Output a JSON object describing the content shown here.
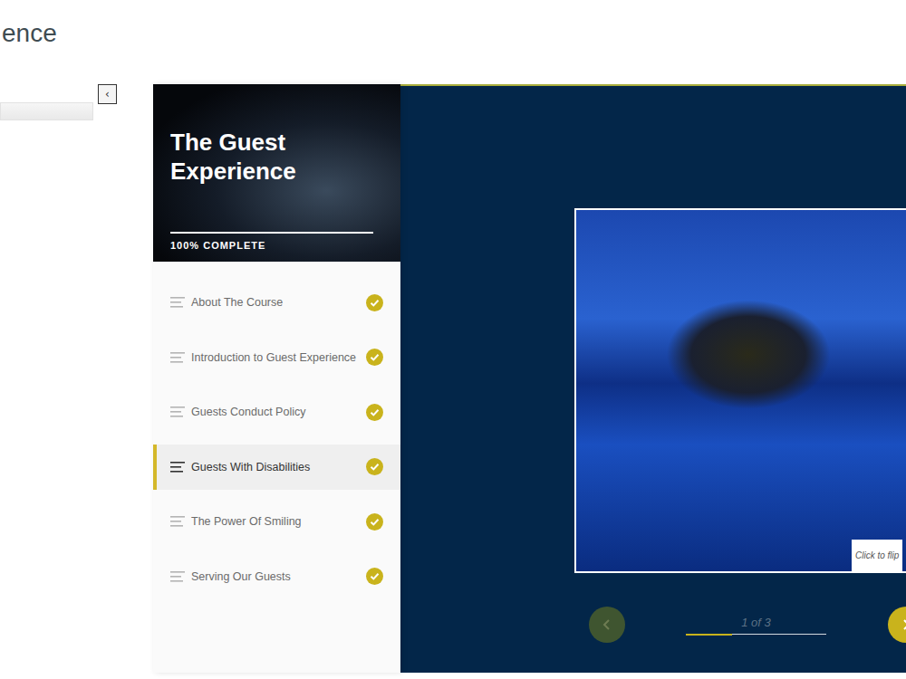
{
  "page": {
    "title": "ence"
  },
  "outline": {
    "toggle_icon": "‹",
    "search": {
      "value": ""
    }
  },
  "course": {
    "title": "The Guest Experience",
    "progress": "100% COMPLETE",
    "level": 1.0
  },
  "lessons": [
    {
      "label": "About The Course",
      "completed": true,
      "selected": false
    },
    {
      "label": "Introduction to Guest Experience",
      "completed": true,
      "selected": false
    },
    {
      "label": "Guests Conduct Policy",
      "completed": true,
      "selected": false
    },
    {
      "label": "Guests With Disabilities",
      "completed": true,
      "selected": true
    },
    {
      "label": "The Power Of Smiling",
      "completed": true,
      "selected": false
    },
    {
      "label": "Serving Our Guests",
      "completed": true,
      "selected": false
    }
  ],
  "card": {
    "hint": "Click to flip"
  },
  "pager": {
    "prev_disabled": true,
    "next_disabled": false,
    "position": "1 of 3",
    "level": 0.33
  }
}
